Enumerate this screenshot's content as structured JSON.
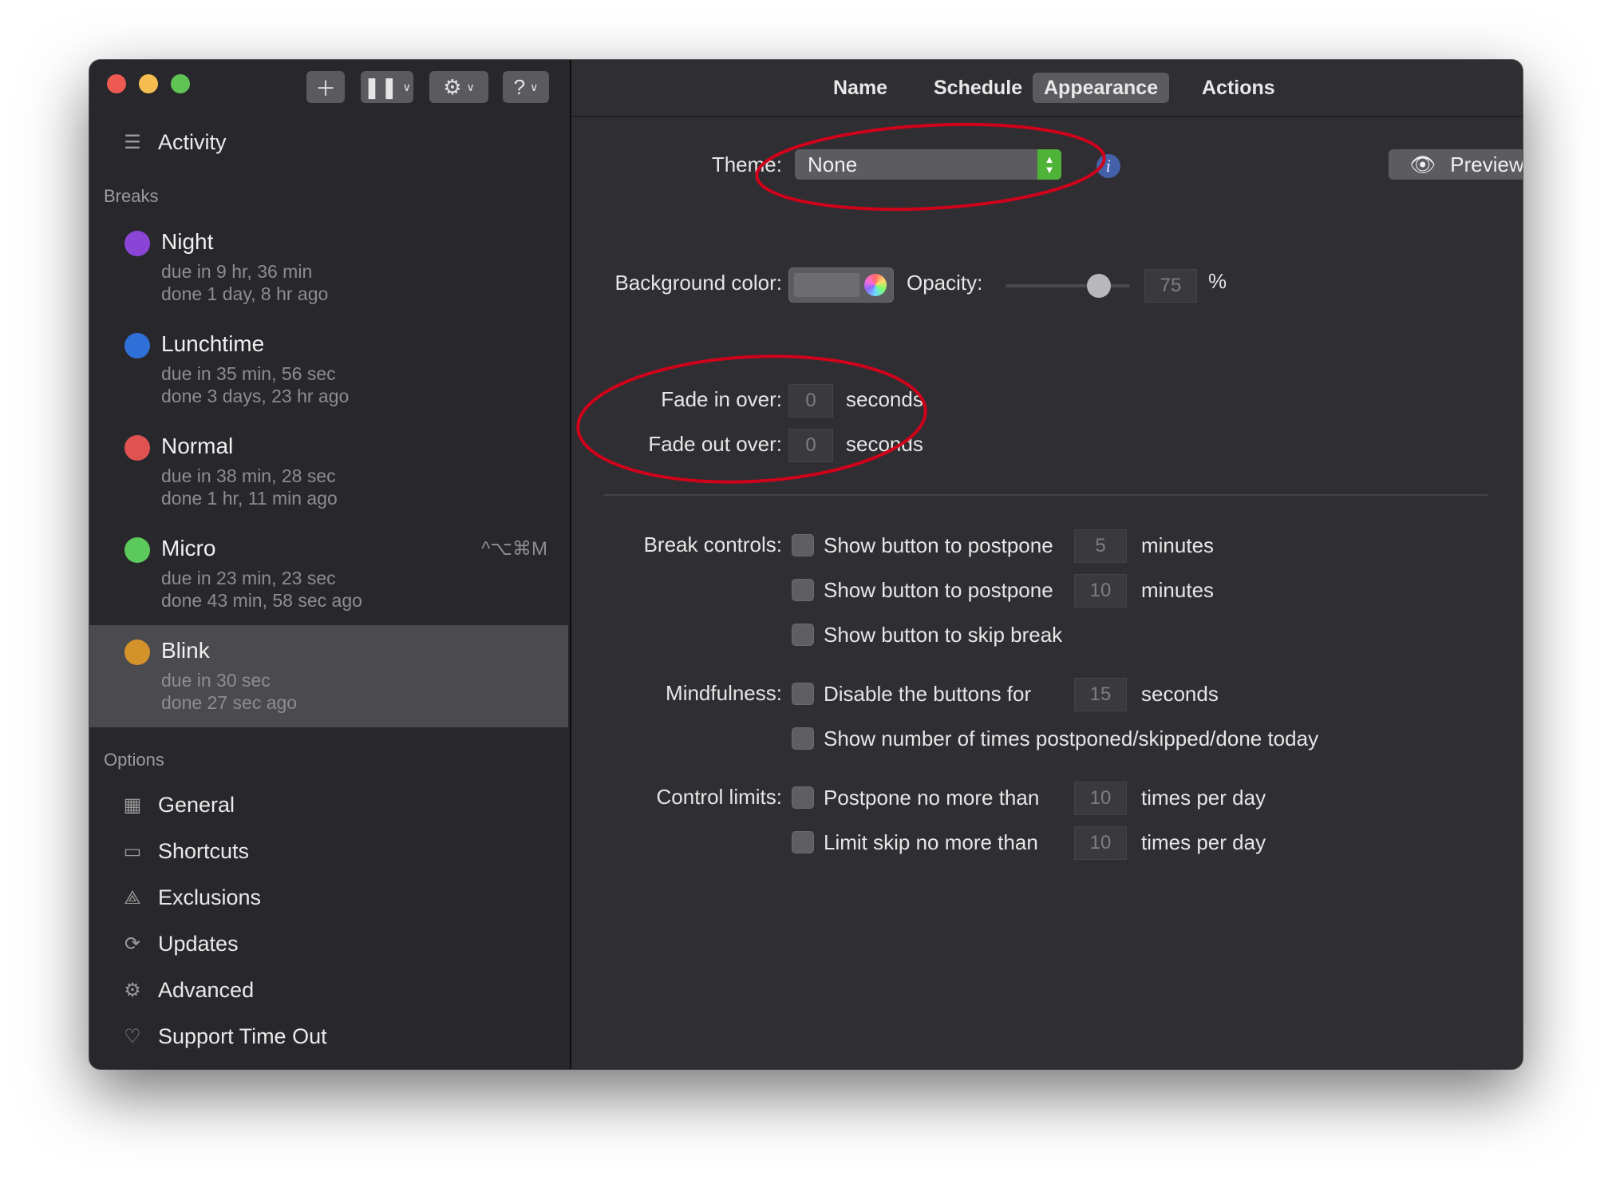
{
  "toolbar": {
    "add_icon": "plus-icon",
    "pause_icon": "pause-icon",
    "settings_icon": "gear-icon",
    "help_label": "?"
  },
  "sidebar": {
    "activity_label": "Activity",
    "breaks_heading": "Breaks",
    "breaks": [
      {
        "name": "Night",
        "due": "due in 9 hr, 36 min",
        "done": "done 1 day, 8 hr ago",
        "color": "#8a45d6",
        "shortcut": ""
      },
      {
        "name": "Lunchtime",
        "due": "due in 35 min, 56 sec",
        "done": "done 3 days, 23 hr ago",
        "color": "#2f6fd8",
        "shortcut": ""
      },
      {
        "name": "Normal",
        "due": "due in 38 min, 28 sec",
        "done": "done 1 hr, 11 min ago",
        "color": "#e05252",
        "shortcut": ""
      },
      {
        "name": "Micro",
        "due": "due in 23 min, 23 sec",
        "done": "done 43 min, 58 sec ago",
        "color": "#5cc95c",
        "shortcut": "^⌥⌘M"
      },
      {
        "name": "Blink",
        "due": "due in 30 sec",
        "done": "done 27 sec ago",
        "color": "#d4922a",
        "shortcut": ""
      }
    ],
    "options_heading": "Options",
    "options": [
      {
        "label": "General",
        "icon": "general-icon"
      },
      {
        "label": "Shortcuts",
        "icon": "keyboard-icon"
      },
      {
        "label": "Exclusions",
        "icon": "exclusions-icon"
      },
      {
        "label": "Updates",
        "icon": "updates-icon"
      },
      {
        "label": "Advanced",
        "icon": "gear-icon"
      },
      {
        "label": "Support Time Out",
        "icon": "heart-icon"
      }
    ]
  },
  "tabs": [
    "Name",
    "Schedule",
    "Appearance",
    "Actions"
  ],
  "active_tab": "Appearance",
  "appearance": {
    "theme_label": "Theme:",
    "theme_value": "None",
    "preview_label": "Preview",
    "background_label": "Background color:",
    "opacity_label": "Opacity:",
    "opacity_value": "75",
    "opacity_unit": "%",
    "opacity_fraction": 0.75,
    "fade_in_label": "Fade in over:",
    "fade_in_value": "0",
    "fade_out_label": "Fade out over:",
    "fade_out_value": "0",
    "seconds_label": "seconds",
    "break_controls_label": "Break controls:",
    "postpone_label": "Show button to postpone",
    "postpone_1_value": "5",
    "postpone_2_value": "10",
    "minutes_label": "minutes",
    "skip_label": "Show button to skip break",
    "mindfulness_label": "Mindfulness:",
    "disable_label": "Disable the buttons for",
    "disable_value": "15",
    "show_count_label": "Show number of times postponed/skipped/done today",
    "control_limits_label": "Control limits:",
    "postpone_limit_label": "Postpone no more than",
    "postpone_limit_value": "10",
    "skip_limit_label": "Limit skip no more than",
    "skip_limit_value": "10",
    "times_per_day_label": "times per day"
  },
  "colors": {
    "annotation_ring": "#d0021b",
    "stepper_green": "#4fb338",
    "info_blue": "#4460a8"
  }
}
